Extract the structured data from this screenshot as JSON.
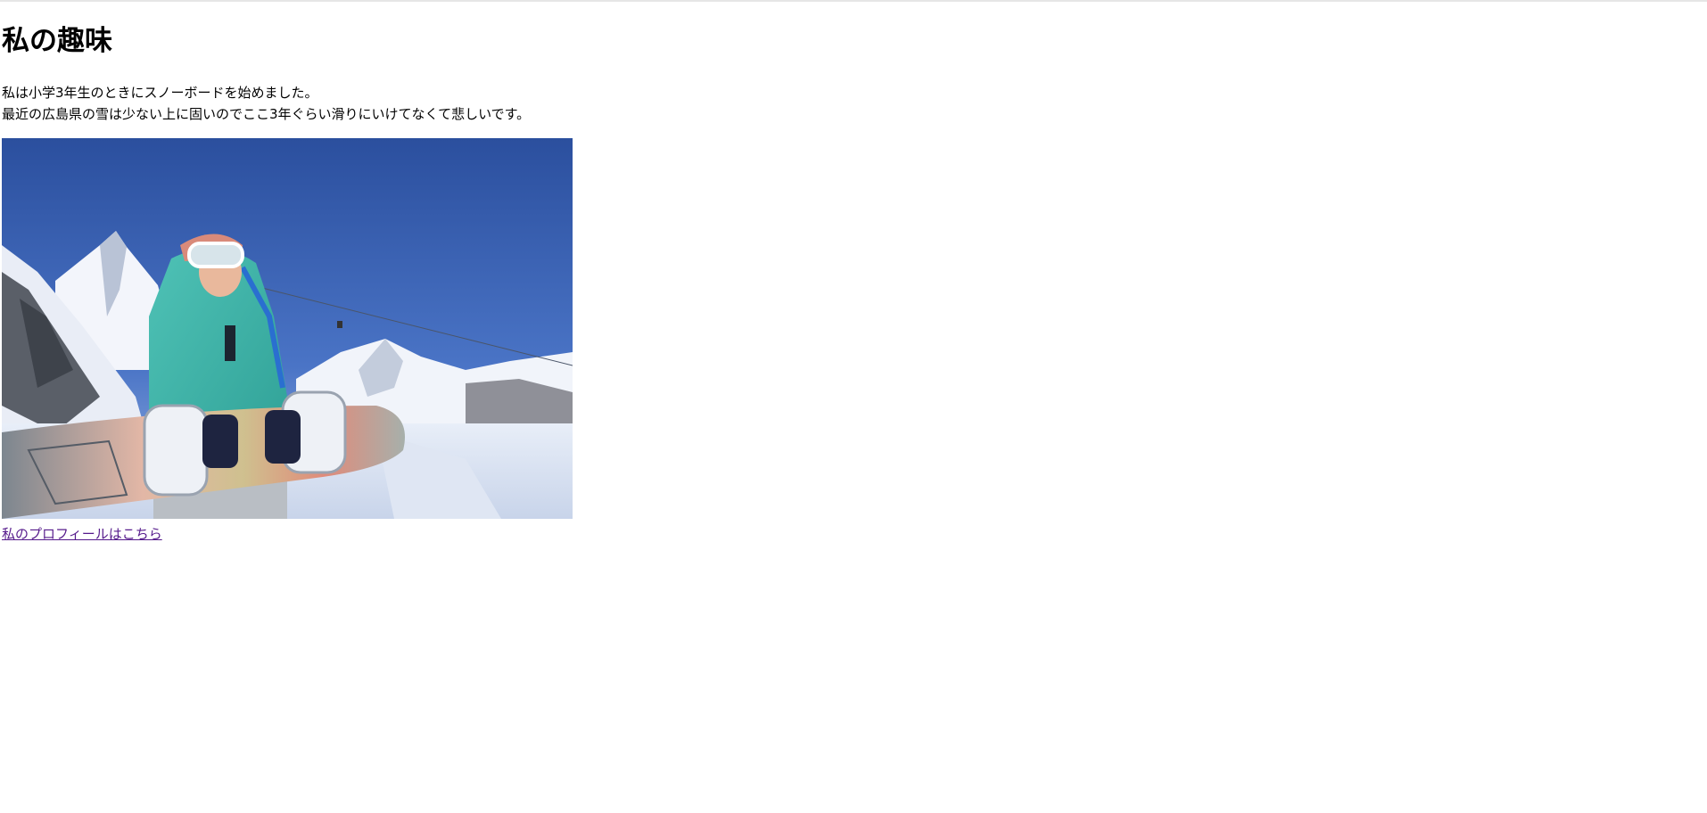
{
  "page": {
    "heading": "私の趣味",
    "paragraph_lines": [
      "私は小学3年生のときにスノーボードを始めました。",
      "最近の広島県の雪は少ない上に固いのでここ3年ぐらい滑りにいけてなくて悲しいです。"
    ],
    "photo": {
      "subject": "snowboarder-holding-board-in-snowy-mountains"
    },
    "profile_link": "私のプロフィールはこちら"
  },
  "colors": {
    "text": "#000000",
    "visited_link": "#551a8b",
    "background": "#ffffff"
  }
}
